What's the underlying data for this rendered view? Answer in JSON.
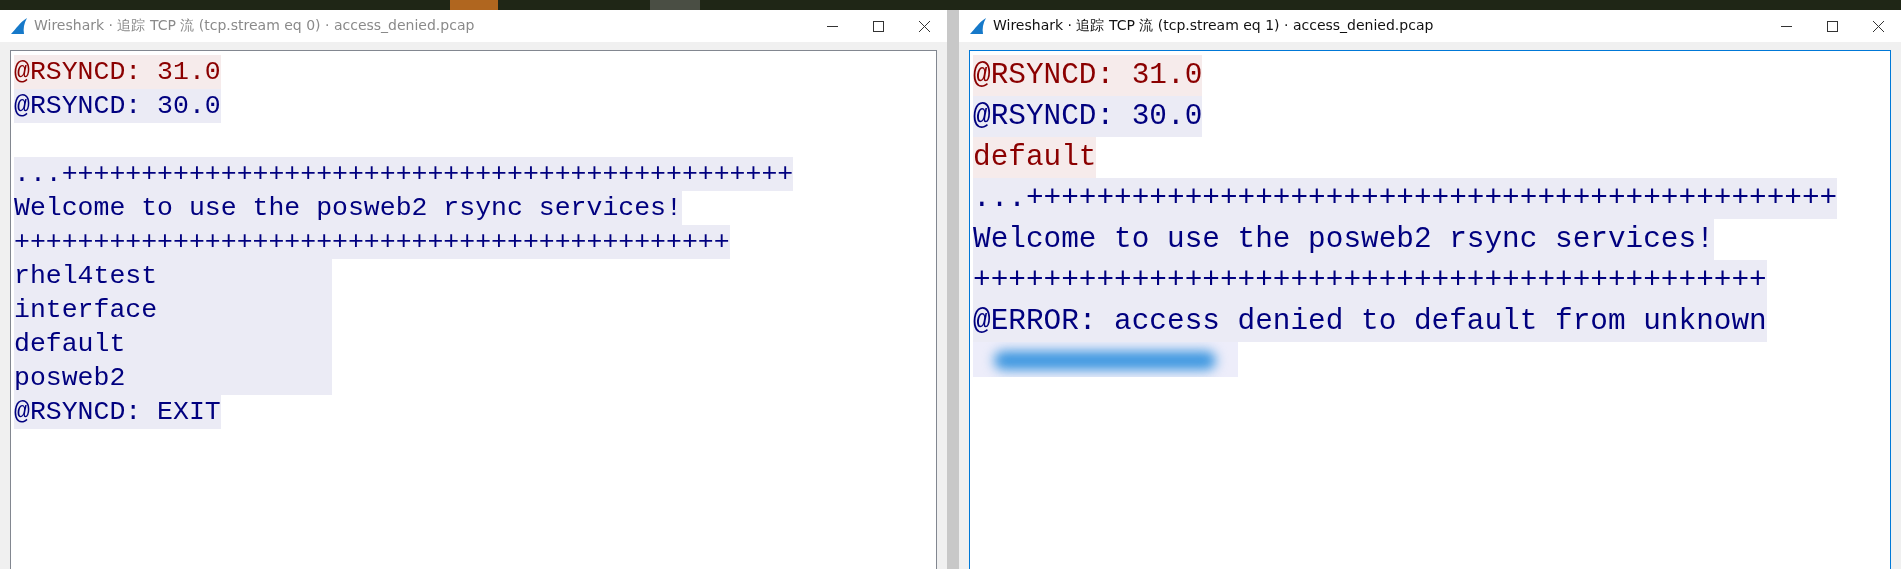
{
  "windows": [
    {
      "title": "Wireshark · 追踪 TCP 流 (tcp.stream eq 0) · access_denied.pcap",
      "active": false,
      "stream": [
        {
          "kind": "line",
          "color": "#8b0000",
          "text": "@RSYNCD: 31.0"
        },
        {
          "kind": "line",
          "color": "#00007f",
          "text": "@RSYNCD: 30.0"
        },
        {
          "kind": "blank"
        },
        {
          "kind": "line",
          "color": "#00007f",
          "text": "...++++++++++++++++++++++++++++++++++++++++++++++"
        },
        {
          "kind": "line",
          "color": "#00007f",
          "text": "Welcome to use the posweb2 rsync services!"
        },
        {
          "kind": "line",
          "color": "#00007f",
          "text": "+++++++++++++++++++++++++++++++++++++++++++++"
        },
        {
          "kind": "listing",
          "color": "#00007f",
          "lines": [
            "rhel4test",
            "interface",
            "default",
            "posweb2"
          ]
        },
        {
          "kind": "line",
          "color": "#00007f",
          "text": "@RSYNCD: EXIT"
        }
      ]
    },
    {
      "title": "Wireshark · 追踪 TCP 流 (tcp.stream eq 1) · access_denied.pcap",
      "active": true,
      "stream": [
        {
          "kind": "line",
          "color": "#8b0000",
          "text": "@RSYNCD: 31.0"
        },
        {
          "kind": "line",
          "color": "#00007f",
          "text": "@RSYNCD: 30.0"
        },
        {
          "kind": "line",
          "color": "#8b0000",
          "text": "default"
        },
        {
          "kind": "line",
          "color": "#00007f",
          "text": "...++++++++++++++++++++++++++++++++++++++++++++++"
        },
        {
          "kind": "line",
          "color": "#00007f",
          "text": "Welcome to use the posweb2 rsync services!"
        },
        {
          "kind": "line",
          "color": "#00007f",
          "text": "+++++++++++++++++++++++++++++++++++++++++++++"
        },
        {
          "kind": "line",
          "color": "#00007f",
          "text": "@ERROR: access denied to default from unknown"
        },
        {
          "kind": "redacted"
        }
      ]
    }
  ]
}
